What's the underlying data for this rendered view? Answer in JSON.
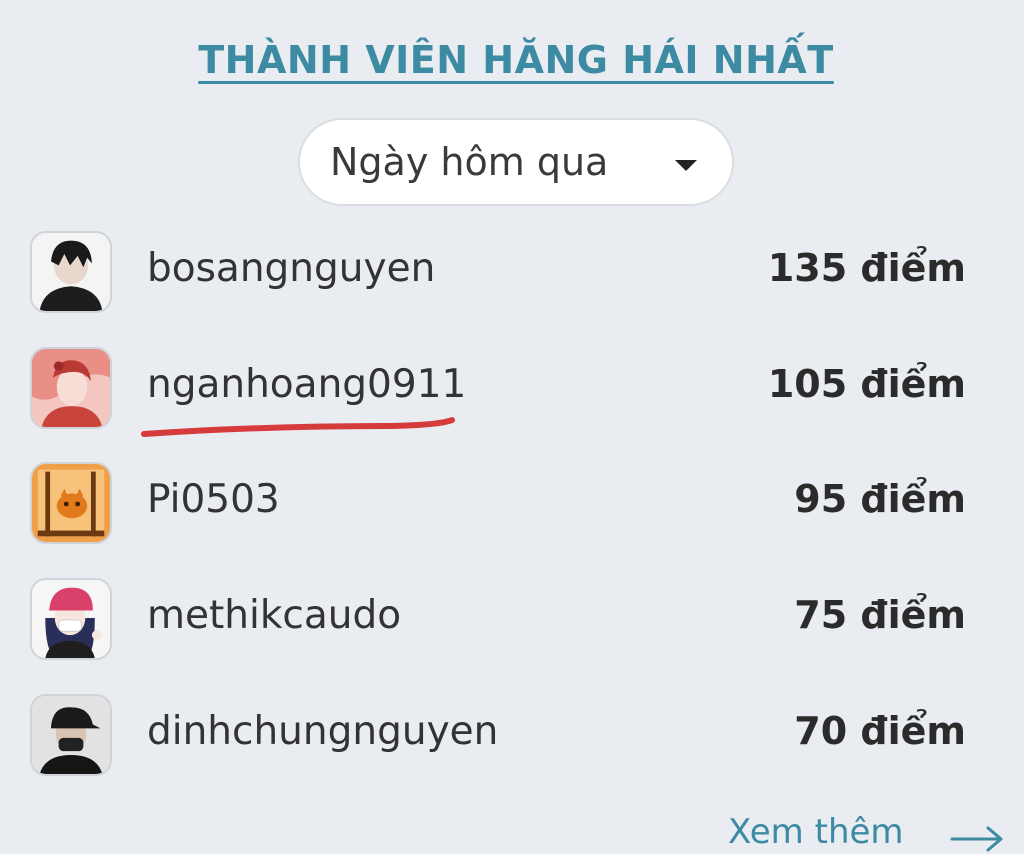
{
  "header": {
    "title": "THÀNH VIÊN HĂNG HÁI NHẤT"
  },
  "period_select": {
    "selected": "Ngày hôm qua"
  },
  "members": [
    {
      "username": "bosangnguyen",
      "points": "135 điểm"
    },
    {
      "username": "nganhoang0911",
      "points": "105 điểm"
    },
    {
      "username": "Pi0503",
      "points": "95 điểm"
    },
    {
      "username": "methikcaudo",
      "points": "75 điểm"
    },
    {
      "username": "dinhchungnguyen",
      "points": "70 điểm"
    }
  ],
  "footer": {
    "see_more": "Xem thêm"
  },
  "colors": {
    "accent": "#3d8aa3",
    "background": "#e9ecf0",
    "highlight_mark": "#d63b3b"
  }
}
